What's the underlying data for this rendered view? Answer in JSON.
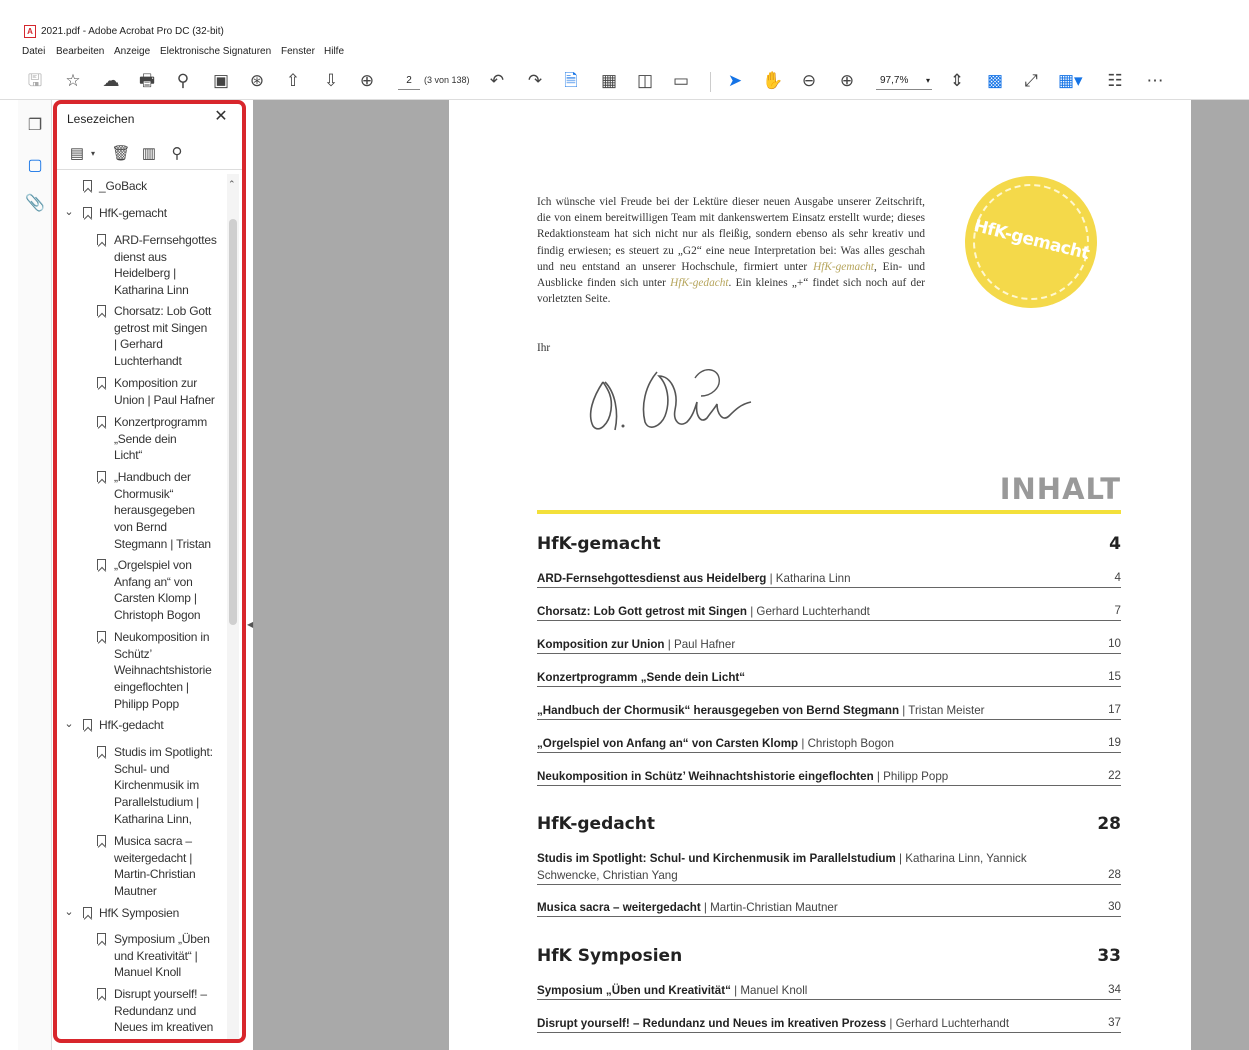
{
  "window": {
    "title": "2021.pdf - Adobe Acrobat Pro DC (32-bit)"
  },
  "menu": [
    "Datei",
    "Bearbeiten",
    "Anzeige",
    "Elektronische Signaturen",
    "Fenster",
    "Hilfe"
  ],
  "toolbar": {
    "page_current": "2",
    "page_of": "(3 von 138)",
    "zoom": "97,7%"
  },
  "bookmarks_panel": {
    "title": "Lesezeichen",
    "items": [
      {
        "text": "_GoBack"
      },
      {
        "text": "HfK-gemacht"
      },
      {
        "text": "ARD-Fernsehgottes\ndienst aus\nHeidelberg |\nKatharina Linn"
      },
      {
        "text": "Chorsatz: Lob Gott\ngetrost mit Singen\n| Gerhard\nLuchterhandt"
      },
      {
        "text": "Komposition zur\nUnion | Paul Hafner"
      },
      {
        "text": "Konzertprogramm\n„Sende dein\nLicht“"
      },
      {
        "text": "„Handbuch der\nChormusik“\nherausgegeben\nvon Bernd\nStegmann | Tristan"
      },
      {
        "text": "„Orgelspiel von\nAnfang an“ von\nCarsten Klomp |\nChristoph Bogon"
      },
      {
        "text": "Neukomposition in\nSchütz’\nWeihnachtshistorie\neingeflochten |\nPhilipp Popp"
      },
      {
        "text": "HfK-gedacht"
      },
      {
        "text": "Studis im Spotlight:\nSchul- und\nKirchenmusik im\nParallelstudium |\nKatharina Linn,"
      },
      {
        "text": "Musica sacra –\nweitergedacht |\nMartin-Christian\nMautner"
      },
      {
        "text": "HfK Symposien"
      },
      {
        "text": "Symposium „Üben\nund Kreativität“ |\nManuel Knoll"
      },
      {
        "text": "Disrupt yourself! –\nRedundanz und\nNeues im kreativen"
      }
    ]
  },
  "document": {
    "intro": {
      "p1": "Ich wünsche viel Freude bei der Lektüre dieser neuen Ausgabe unserer Zeitschrift, die von einem bereitwilligen Team mit dankenswertem Einsatz erstellt wurde; dieses Redaktionsteam hat sich nicht nur als fleißig, sondern ebenso als sehr kreativ und findig erwiesen; es steuert zu „G2“ eine neue Interpretation bei: Was alles geschah und neu entstand an unserer Hochschule, firmiert unter ",
      "link1": "HfK-gemacht",
      "p2": ", Ein- und Ausblicke finden sich unter ",
      "link2": "HfK-gedacht",
      "p3": ". Ein kleines „+“ findet sich noch auf der vorletzten Seite."
    },
    "closing": "Ihr",
    "stamp": "HfK-gemacht",
    "toc_heading": "INHALT",
    "sections": [
      {
        "name": "HfK-gemacht",
        "page": "4"
      },
      {
        "name": "HfK-gedacht",
        "page": "28"
      },
      {
        "name": "HfK Symposien",
        "page": "33"
      }
    ],
    "entries": [
      {
        "title": "ARD-Fernsehgottesdienst aus Heidelberg",
        "author": " | Katharina Linn",
        "page": "4"
      },
      {
        "title": "Chorsatz: Lob Gott getrost mit Singen",
        "author": " | Gerhard Luchterhandt",
        "page": "7"
      },
      {
        "title": "Komposition zur Union",
        "author": " | Paul Hafner",
        "page": "10"
      },
      {
        "title": "Konzertprogramm „Sende dein Licht“",
        "author": "",
        "page": "15"
      },
      {
        "title": "„Handbuch der Chormusik“ herausgegeben von Bernd Stegmann",
        "author": " | Tristan Meister",
        "page": "17"
      },
      {
        "title": "„Orgelspiel von Anfang an“ von Carsten Klomp",
        "author": " | Christoph Bogon",
        "page": "19"
      },
      {
        "title": "Neukomposition in Schütz’ Weihnachtshistorie eingeflochten",
        "author": " | Philipp Popp",
        "page": "22"
      },
      {
        "title": "Studis im Spotlight: Schul- und Kirchenmusik im Parallelstudium",
        "author": " | Katharina Linn, Yannick Schwencke, Christian Yang",
        "page": "28"
      },
      {
        "title": "Musica sacra – weitergedacht",
        "author": " | Martin-Christian Mautner",
        "page": "30"
      },
      {
        "title": "Symposium „Üben und Kreativität“",
        "author": " | Manuel Knoll",
        "page": "34"
      },
      {
        "title": "Disrupt yourself! – Redundanz und Neues im kreativen Prozess",
        "author": " | Gerhard Luchterhandt",
        "page": "37"
      }
    ]
  }
}
